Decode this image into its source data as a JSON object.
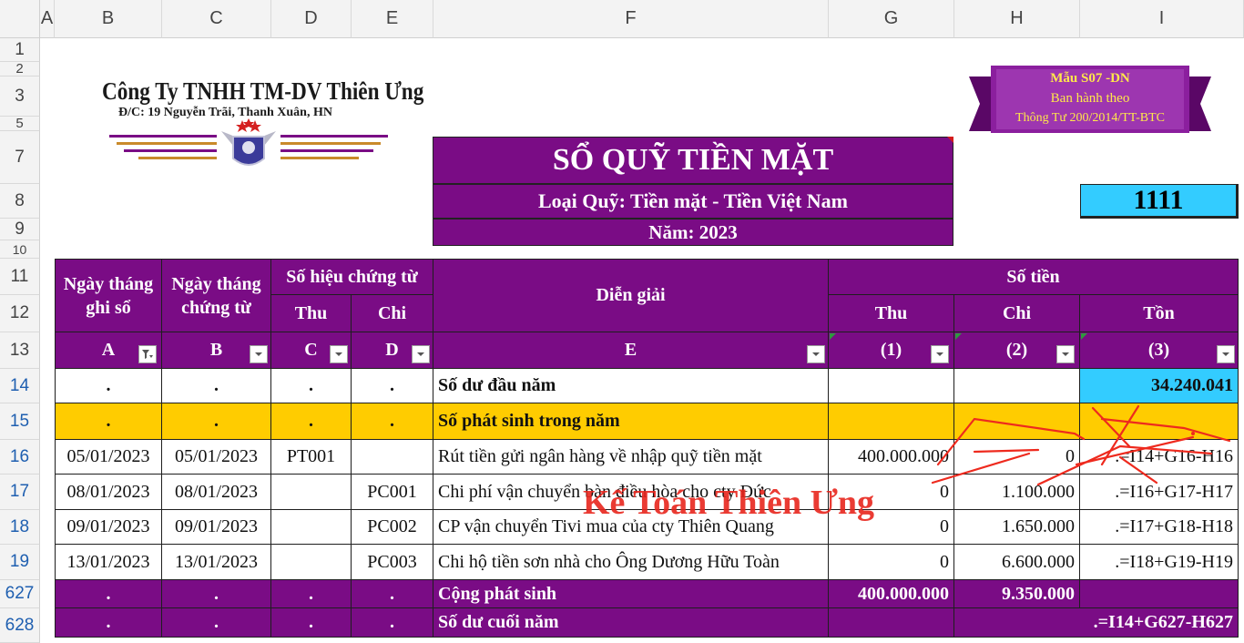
{
  "columns": [
    "A",
    "B",
    "C",
    "D",
    "E",
    "F",
    "G",
    "H",
    "I"
  ],
  "rows": [
    "1",
    "2",
    "3",
    "5",
    "7",
    "8",
    "9",
    "10",
    "11",
    "12",
    "13",
    "14",
    "15",
    "16",
    "17",
    "18",
    "19",
    "627",
    "628"
  ],
  "company": {
    "name": "Công Ty TNHH TM-DV Thiên Ưng",
    "address": "Đ/C: 19 Nguyễn Trãi, Thanh Xuân, HN"
  },
  "form_badge": {
    "line1": "Mẫu S07 -DN",
    "line2": "Ban hành theo",
    "line3": "Thông Tư 200/2014/TT-BTC"
  },
  "title": {
    "main": "SỔ QUỸ TIỀN MẶT",
    "fund_type": "Loại Quỹ: Tiền mặt - Tiền Việt Nam",
    "year": "Năm: 2023"
  },
  "account_code": "1111",
  "table_header": {
    "col_a": "Ngày tháng ghi sổ",
    "col_b": "Ngày tháng chứng từ",
    "voucher": "Số hiệu chứng từ",
    "thu": "Thu",
    "chi": "Chi",
    "dien_giai": "Diễn giải",
    "so_tien": "Số tiền",
    "amt_thu": "Thu",
    "amt_chi": "Chi",
    "amt_ton": "Tồn",
    "code_a": "A",
    "code_b": "B",
    "code_c": "C",
    "code_d": "D",
    "code_e": "E",
    "code_1": "(1)",
    "code_2": "(2)",
    "code_3": "(3)"
  },
  "opening": {
    "dot": ".",
    "label": "Số dư đầu năm",
    "balance": "34.240.041"
  },
  "arising": {
    "dot": ".",
    "label": "Số phát sinh trong năm"
  },
  "entries": [
    {
      "ghi_so": "05/01/2023",
      "chung_tu": "05/01/2023",
      "thu": "PT001",
      "chi": "",
      "desc": "Rút tiền gửi ngân hàng về nhập quỹ tiền mặt",
      "amt_thu": "400.000.000",
      "amt_chi": "0",
      "ton": ".=I14+G16-H16"
    },
    {
      "ghi_so": "08/01/2023",
      "chung_tu": "08/01/2023",
      "thu": "",
      "chi": "PC001",
      "desc": "Chi phí vận chuyển bàn điều hòa cho cty Đức",
      "amt_thu": "0",
      "amt_chi": "1.100.000",
      "ton": ".=I16+G17-H17"
    },
    {
      "ghi_so": "09/01/2023",
      "chung_tu": "09/01/2023",
      "thu": "",
      "chi": "PC002",
      "desc": "CP vận chuyển Tivi mua của cty Thiên Quang",
      "amt_thu": "0",
      "amt_chi": "1.650.000",
      "ton": ".=I17+G18-H18"
    },
    {
      "ghi_so": "13/01/2023",
      "chung_tu": "13/01/2023",
      "thu": "",
      "chi": "PC003",
      "desc": "Chi hộ tiền sơn nhà cho Ông Dương Hữu Toàn",
      "amt_thu": "0",
      "amt_chi": "6.600.000",
      "ton": ".=I18+G19-H19"
    }
  ],
  "total_arising": {
    "dot": ".",
    "label": "Cộng phát sinh",
    "thu": "400.000.000",
    "chi": "9.350.000"
  },
  "closing": {
    "dot": ".",
    "label": "Số dư cuối năm",
    "balance": ".=I14+G627-H627"
  },
  "watermark": "Kế Toán Thiên Ưng",
  "colors": {
    "purple": "#7a0c85",
    "yellow": "#ffcc00",
    "cyan": "#33ccff",
    "watermark": "#e8261e"
  }
}
